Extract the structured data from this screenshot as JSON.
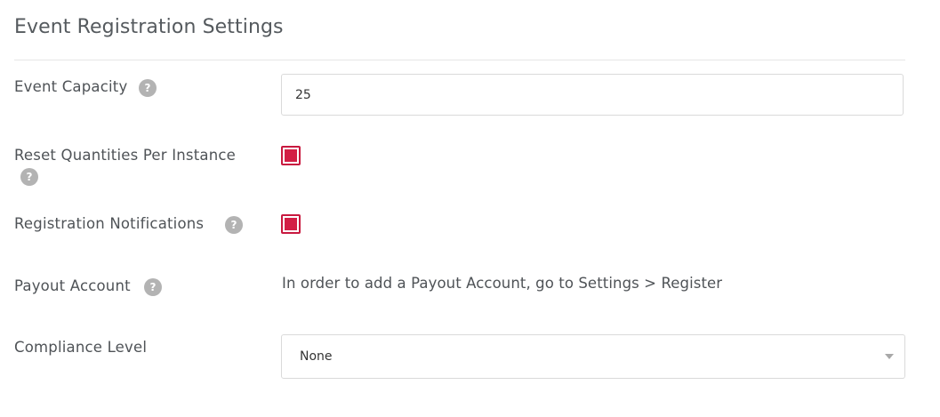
{
  "page": {
    "title": "Event Registration Settings"
  },
  "fields": {
    "event_capacity": {
      "label": "Event Capacity",
      "value": "25",
      "help_icon": "question-mark"
    },
    "reset_quantities": {
      "label": "Reset Quantities Per Instance",
      "checked": true,
      "help_icon": "question-mark"
    },
    "registration_notifications": {
      "label": "Registration Notifications",
      "checked": true,
      "help_icon": "question-mark"
    },
    "payout_account": {
      "label": "Payout Account",
      "info": "In order to add a Payout Account, go to Settings > Register",
      "help_icon": "question-mark"
    },
    "compliance_level": {
      "label": "Compliance Level",
      "selected": "None"
    }
  },
  "colors": {
    "accent": "#d31e45",
    "help_icon_bg": "#b3b3b3",
    "border": "#dadada"
  },
  "help_glyph": "?"
}
